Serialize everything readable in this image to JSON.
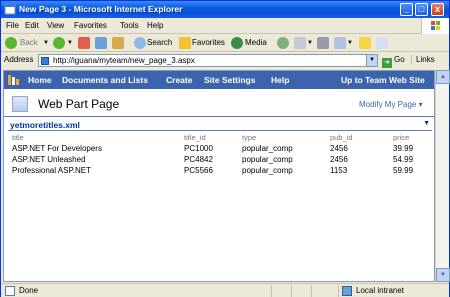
{
  "window": {
    "title": "New Page 3 - Microsoft Internet Explorer",
    "buttons": {
      "minimize": "_",
      "maximize": "□",
      "close": "x"
    }
  },
  "menu": [
    "File",
    "Edit",
    "View",
    "Favorites",
    "Tools",
    "Help"
  ],
  "toolbar": {
    "back": "Back",
    "search": "Search",
    "favorites": "Favorites",
    "media": "Media"
  },
  "address": {
    "label": "Address",
    "url": "http://iguana/myteam/new_page_3.aspx",
    "go": "Go",
    "links": "Links"
  },
  "sharepoint": {
    "nav": [
      "Home",
      "Documents and Lists",
      "Create",
      "Site Settings",
      "Help"
    ],
    "up_link": "Up to Team Web Site",
    "page_title": "Web Part Page",
    "modify": "Modify My Page",
    "webpart": {
      "title": "yetmoretitles.xml",
      "columns": [
        "title",
        "title_id",
        "type",
        "pub_id",
        "price"
      ],
      "rows": [
        [
          "ASP.NET For Developers",
          "PC1000",
          "popular_comp",
          "2456",
          "39.99"
        ],
        [
          "ASP.NET Unleashed",
          "PC4842",
          "popular_comp",
          "2456",
          "54.99"
        ],
        [
          "Professional ASP.NET",
          "PC5566",
          "popular_comp",
          "1153",
          "59.99"
        ]
      ]
    }
  },
  "status": {
    "text": "Done",
    "zone": "Local intranet"
  },
  "colors": {
    "nav_bg": "#3c63ad",
    "title_blue": "#003399",
    "titlebar": "#0a5ce0"
  }
}
